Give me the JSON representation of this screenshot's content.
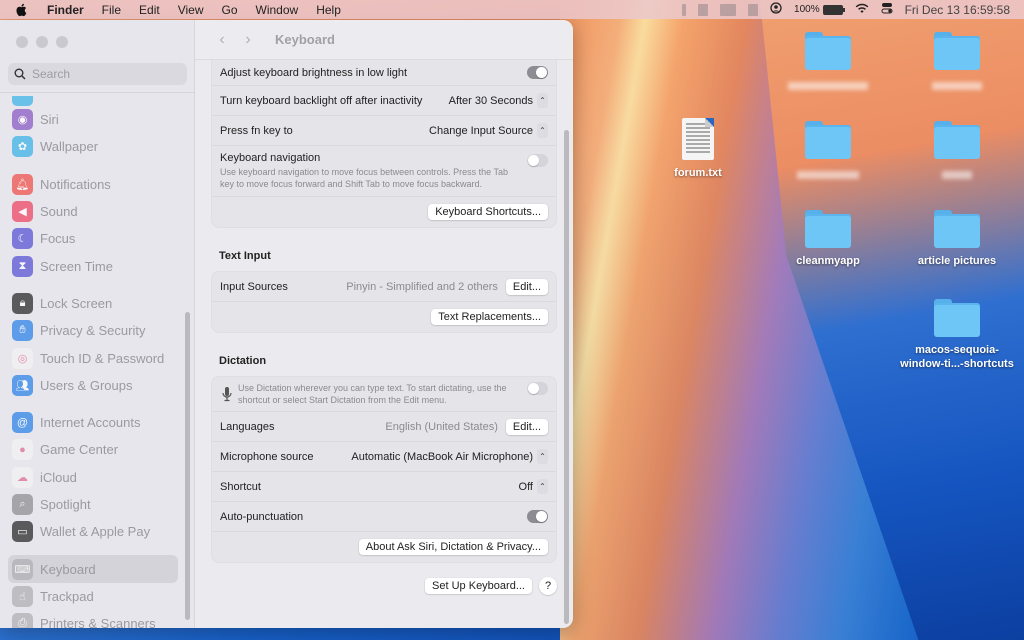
{
  "menubar": {
    "app_name": "Finder",
    "items": [
      "File",
      "Edit",
      "View",
      "Go",
      "Window",
      "Help"
    ],
    "battery": "100%",
    "clock": "Fri Dec 13  16:59:58"
  },
  "window": {
    "search_placeholder": "Search",
    "title": "Keyboard",
    "sidebar": [
      {
        "label": "Siri",
        "icon": "siri-icon",
        "color": "#8b5cc4"
      },
      {
        "label": "Wallpaper",
        "icon": "wallpaper-icon",
        "color": "#3fb4e8"
      },
      {
        "label": "Notifications",
        "icon": "bell-icon",
        "color": "#f0534c",
        "gap": true
      },
      {
        "label": "Sound",
        "icon": "speaker-icon",
        "color": "#f04866"
      },
      {
        "label": "Focus",
        "icon": "moon-icon",
        "color": "#5b55d6"
      },
      {
        "label": "Screen Time",
        "icon": "hourglass-icon",
        "color": "#5b55d6"
      },
      {
        "label": "Lock Screen",
        "icon": "lock-icon",
        "color": "#2c2c2e",
        "gap": true
      },
      {
        "label": "Privacy & Security",
        "icon": "hand-icon",
        "color": "#2f84e8"
      },
      {
        "label": "Touch ID & Password",
        "icon": "fingerprint-icon",
        "color": "#f2f2f4"
      },
      {
        "label": "Users & Groups",
        "icon": "users-icon",
        "color": "#2f84e8"
      },
      {
        "label": "Internet Accounts",
        "icon": "at-icon",
        "color": "#2f84e8",
        "gap": true
      },
      {
        "label": "Game Center",
        "icon": "game-center-icon",
        "color": "#f2f2f4"
      },
      {
        "label": "iCloud",
        "icon": "cloud-icon",
        "color": "#f2f2f4"
      },
      {
        "label": "Spotlight",
        "icon": "magnifier-icon",
        "color": "#8e8e93"
      },
      {
        "label": "Wallet & Apple Pay",
        "icon": "wallet-icon",
        "color": "#2c2c2e"
      },
      {
        "label": "Keyboard",
        "icon": "keyboard-icon",
        "color": "#b0b0b5",
        "gap": true,
        "selected": true
      },
      {
        "label": "Trackpad",
        "icon": "trackpad-icon",
        "color": "#b0b0b5"
      },
      {
        "label": "Printers & Scanners",
        "icon": "printer-icon",
        "color": "#b0b0b5"
      }
    ],
    "keyboard_group": {
      "brightness_label": "Adjust keyboard brightness in low light",
      "brightness_on": true,
      "backlight_label": "Turn keyboard backlight off after inactivity",
      "backlight_value": "After 30 Seconds",
      "fn_label": "Press fn key to",
      "fn_value": "Change Input Source",
      "nav_label": "Keyboard navigation",
      "nav_desc": "Use keyboard navigation to move focus between controls. Press the Tab key to move focus forward and Shift Tab to move focus backward.",
      "nav_on": false,
      "shortcuts_button": "Keyboard Shortcuts..."
    },
    "text_input": {
      "title": "Text Input",
      "sources_label": "Input Sources",
      "sources_value": "Pinyin - Simplified and 2 others",
      "edit_button": "Edit...",
      "replacements_button": "Text Replacements..."
    },
    "dictation": {
      "title": "Dictation",
      "desc": "Use Dictation wherever you can type text. To start dictating, use the shortcut or select Start Dictation from the Edit menu.",
      "enabled": false,
      "languages_label": "Languages",
      "languages_value": "English (United States)",
      "edit_button": "Edit...",
      "mic_label": "Microphone source",
      "mic_value": "Automatic (MacBook Air Microphone)",
      "shortcut_label": "Shortcut",
      "shortcut_value": "Off",
      "autopunct_label": "Auto-punctuation",
      "autopunct_on": true,
      "privacy_button": "About Ask Siri, Dictation & Privacy..."
    },
    "setup_button": "Set Up Keyboard...",
    "help_button": "?"
  },
  "desktop": {
    "items": [
      {
        "label": "forum.txt",
        "type": "document"
      },
      {
        "label": "(blurred)",
        "type": "folder",
        "blurred": true
      },
      {
        "label": "(blurred)",
        "type": "folder",
        "blurred": true
      },
      {
        "label": "(blurred)",
        "type": "folder",
        "blurred": true
      },
      {
        "label": "(blurred)",
        "type": "folder",
        "blurred": true
      },
      {
        "label": "cleanmyapp",
        "type": "folder"
      },
      {
        "label": "article pictures",
        "type": "folder"
      },
      {
        "label": "macos-sequoia-window-ti...-shortcuts",
        "type": "folder"
      }
    ]
  }
}
